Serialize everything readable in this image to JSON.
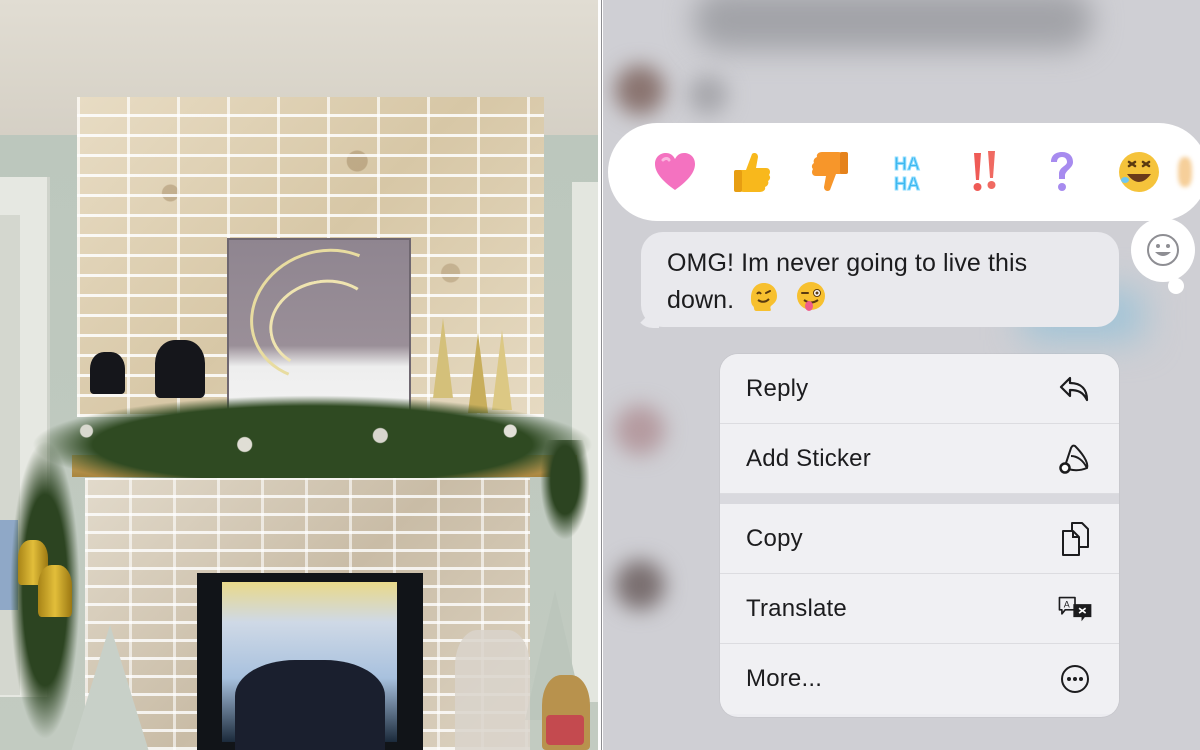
{
  "left_photo": {
    "subject": "brick fireplace with Christmas mantel decor"
  },
  "conversation": {
    "tapbacks": [
      {
        "name": "heart",
        "label": "Heart",
        "color": "#f472c0"
      },
      {
        "name": "thumbs-up",
        "label": "Like",
        "color": "#f8b81c"
      },
      {
        "name": "thumbs-down",
        "label": "Dislike",
        "color": "#f7962a"
      },
      {
        "name": "haha",
        "label": "HA HA",
        "color": "#3fb8ef"
      },
      {
        "name": "exclamation",
        "label": "!!",
        "color": "#ef5b56"
      },
      {
        "name": "question",
        "label": "?",
        "color": "#a78bef"
      },
      {
        "name": "rofl",
        "label": "Rolling on the floor laughing",
        "color": "#f5c33b"
      }
    ],
    "add_emoji_icon": "smiley-face",
    "message": {
      "line1": "OMG! Im never going to live this",
      "line2": "down.",
      "emojis": [
        "melting-face",
        "winking-face-with-tongue"
      ]
    }
  },
  "context_menu": {
    "items": [
      {
        "label": "Reply",
        "icon": "reply-arrow"
      },
      {
        "label": "Add Sticker",
        "icon": "sticker-peel"
      },
      {
        "label": "Copy",
        "icon": "documents-copy"
      },
      {
        "label": "Translate",
        "icon": "translate-bubbles"
      },
      {
        "label": "More...",
        "icon": "ellipsis-circle"
      }
    ]
  }
}
